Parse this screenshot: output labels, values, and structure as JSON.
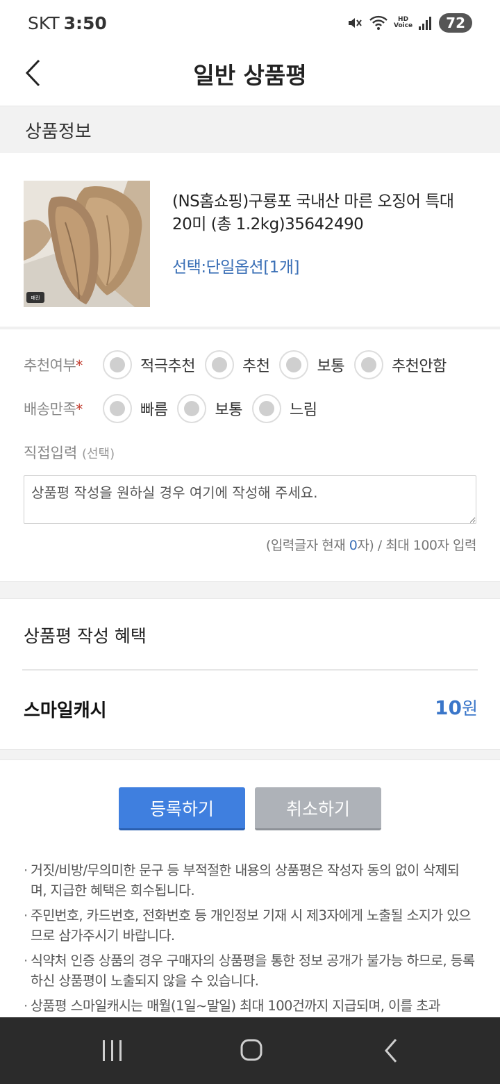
{
  "status_bar": {
    "carrier": "SKT",
    "time": "3:50",
    "hd_top": "HD",
    "hd_bottom": "Voice",
    "battery": "72"
  },
  "header": {
    "title": "일반 상품평"
  },
  "product_section": {
    "title": "상품정보"
  },
  "product": {
    "name": "(NS홈쇼핑)구룡포 국내산 마른 오징어 특대 20미 (총 1.2kg)35642490",
    "option": "선택:단일옵션[1개]",
    "image_badge": "매진"
  },
  "recommend": {
    "label": "추천여부",
    "required_mark": "*",
    "options": [
      "적극추천",
      "추천",
      "보통",
      "추천안함"
    ]
  },
  "delivery": {
    "label": "배송만족",
    "required_mark": "*",
    "options": [
      "빠름",
      "보통",
      "느림"
    ]
  },
  "direct_input": {
    "label": "직접입력",
    "optional": "(선택)",
    "placeholder": "상품평 작성을 원하실 경우 여기에 작성해 주세요.",
    "count_prefix": "(입력글자 현재 ",
    "count_value": "0",
    "count_suffix": "자) / 최대 100자 입력"
  },
  "benefit": {
    "title": "상품평 작성 혜택",
    "cash_label": "스마일캐시",
    "cash_amount": "10",
    "cash_unit": "원"
  },
  "buttons": {
    "register": "등록하기",
    "cancel": "취소하기"
  },
  "notices": [
    "거짓/비방/무의미한 문구 등 부적절한 내용의 상품평은 작성자 동의 없이 삭제되며, 지급한 혜택은 회수됩니다.",
    "주민번호, 카드번호, 전화번호 등 개인정보 기재 시 제3자에게 노출될 소지가 있으므로 삼가주시기 바랍니다.",
    "식약처 인증 상품의 경우 구매자의 상품평을 통한 정보 공개가 불가능 하므로, 등록하신 상품평이 노출되지 않을 수 있습니다.",
    "상품평 스마일캐시는 매월(1일~말일) 최대 100건까지 지급되며, 이를 초과"
  ],
  "colors": {
    "accent": "#3f7fdf",
    "link": "#3a6fb6",
    "required": "#c0392b",
    "cancel": "#aeb2b8"
  }
}
